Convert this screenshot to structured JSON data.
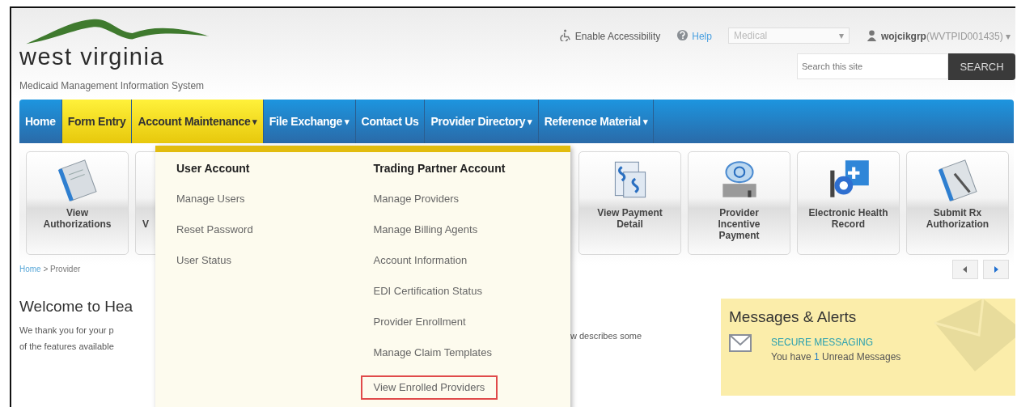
{
  "header": {
    "logo_text": "west virginia",
    "subtitle": "Medicaid Management Information System",
    "accessibility": "Enable Accessibility",
    "help": "Help",
    "program_select": {
      "value": "Medical",
      "caret": "▾"
    },
    "user": {
      "name": "wojcikgrp",
      "id": "(WVTPID001435)",
      "caret": "▾"
    },
    "search": {
      "placeholder": "Search this site",
      "button": "SEARCH"
    }
  },
  "nav": [
    {
      "label": "Home",
      "selected": false
    },
    {
      "label": "Form Entry",
      "selected": true
    },
    {
      "label": "Account Maintenance",
      "selected": true,
      "caret": "▾"
    },
    {
      "label": "File Exchange",
      "selected": false,
      "caret": "▾"
    },
    {
      "label": "Contact Us",
      "selected": false
    },
    {
      "label": "Provider Directory",
      "selected": false,
      "caret": "▾"
    },
    {
      "label": "Reference Material",
      "selected": false,
      "caret": "▾"
    }
  ],
  "tiles_left": [
    {
      "label": "View Authorizations",
      "kind": "document"
    },
    {
      "label": "V",
      "kind": "partial"
    }
  ],
  "tiles_right": [
    {
      "label": "View Payment Detail",
      "kind": "payment"
    },
    {
      "label": "Provider Incentive Payment",
      "kind": "incentive"
    },
    {
      "label": "Electronic Health Record",
      "kind": "ehr"
    },
    {
      "label": "Submit Rx Authorization",
      "kind": "rx"
    }
  ],
  "breadcrumb": {
    "home": "Home",
    "separator": ">",
    "current": "Provider"
  },
  "welcome": {
    "heading": "Welcome to Hea",
    "lines": [
      "We thank you for your p",
      "of the features available"
    ],
    "right_fragment": "w describes some"
  },
  "messages": {
    "title": "Messages & Alerts",
    "link": "SECURE MESSAGING",
    "prefix": "You have",
    "count": "1",
    "suffix": "Unread Messages"
  },
  "dropdown": {
    "columns": [
      {
        "heading": "User Account",
        "items": [
          {
            "label": "Manage Users",
            "highlighted": false
          },
          {
            "label": "Reset Password",
            "highlighted": false
          },
          {
            "label": "User Status",
            "highlighted": false
          }
        ]
      },
      {
        "heading": "Trading Partner Account",
        "items": [
          {
            "label": "Manage Providers",
            "highlighted": false
          },
          {
            "label": "Manage Billing Agents",
            "highlighted": false
          },
          {
            "label": "Account Information",
            "highlighted": false
          },
          {
            "label": "EDI Certification Status",
            "highlighted": false
          },
          {
            "label": "Provider Enrollment",
            "highlighted": false
          },
          {
            "label": "Manage Claim Templates",
            "highlighted": false
          },
          {
            "label": "View Enrolled Providers",
            "highlighted": true
          }
        ]
      }
    ]
  }
}
